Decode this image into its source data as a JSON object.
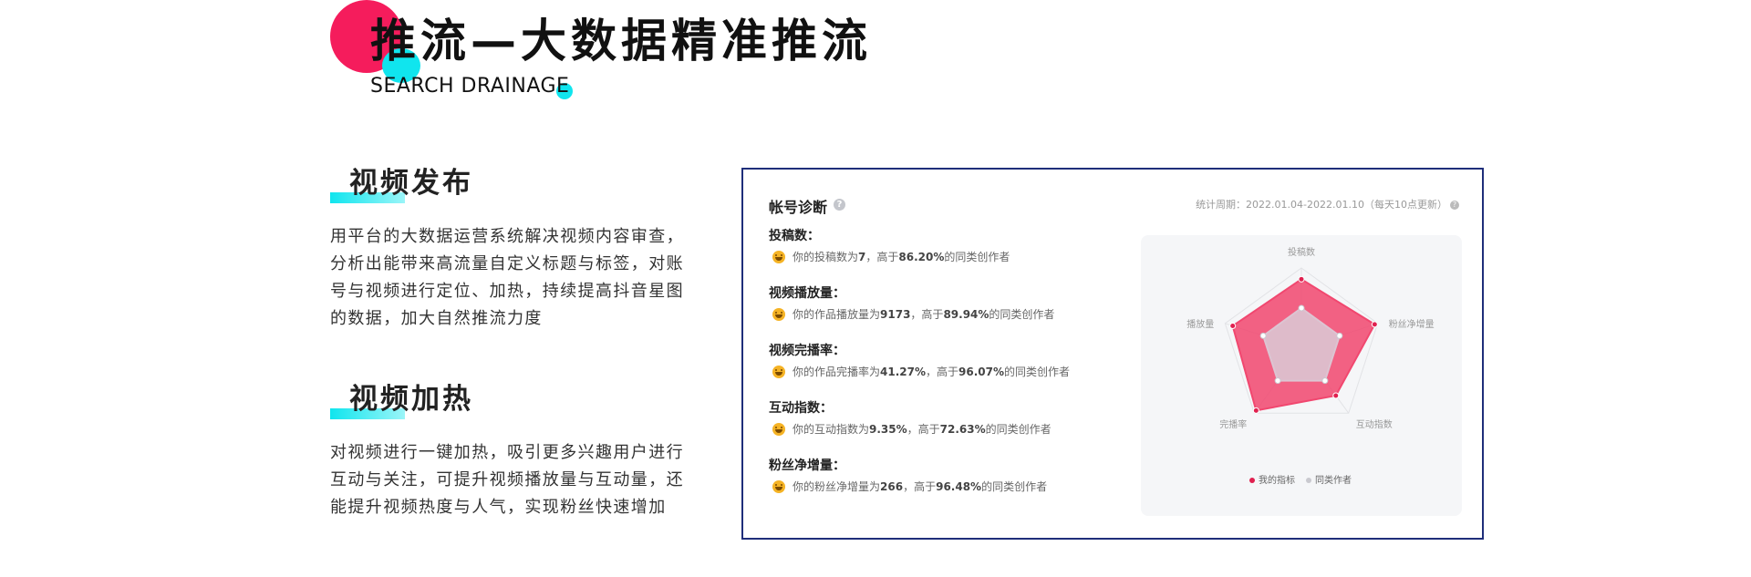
{
  "header": {
    "title": "推流—大数据精准推流",
    "subtitle": "SEARCH DRAINAGE"
  },
  "sections": [
    {
      "title": "视频发布",
      "body": "用平台的大数据运营系统解决视频内容审查，分析出能带来高流量自定义标题与标签，对账号与视频进行定位、加热，持续提高抖音星图的数据，加大自然推流力度"
    },
    {
      "title": "视频加热",
      "body": "对视频进行一键加热，吸引更多兴趣用户进行互动与关注，可提升视频播放量与互动量，还能提升视频热度与人气，实现粉丝快速增加"
    }
  ],
  "panel": {
    "title": "帐号诊断",
    "help_icon": "help-circle-icon",
    "period": "统计周期：2022.01.04-2022.01.10（每天10点更新）",
    "metrics": [
      {
        "label": "投稿数：",
        "prefix": "你的投稿数为",
        "value": "7",
        "mid": "，高于",
        "percent": "86.20%",
        "suffix": "的同类创作者"
      },
      {
        "label": "视频播放量：",
        "prefix": "你的作品播放量为",
        "value": "9173",
        "mid": "，高于",
        "percent": "89.94%",
        "suffix": "的同类创作者"
      },
      {
        "label": "视频完播率：",
        "prefix": "你的作品完播率为",
        "value": "41.27%",
        "mid": "，高于",
        "percent": "96.07%",
        "suffix": "的同类创作者"
      },
      {
        "label": "互动指数：",
        "prefix": "你的互动指数为",
        "value": "9.35%",
        "mid": "，高于",
        "percent": "72.63%",
        "suffix": "的同类创作者"
      },
      {
        "label": "粉丝净增量：",
        "prefix": "你的粉丝净增量为",
        "value": "266",
        "mid": "，高于",
        "percent": "96.48%",
        "suffix": "的同类创作者"
      }
    ],
    "emoji_icon": "smile-emoji-icon"
  },
  "chart_data": {
    "type": "radar",
    "axes": [
      "投稿数",
      "粉丝净增量",
      "互动指数",
      "完播率",
      "播放量"
    ],
    "series": [
      {
        "name": "我的指标",
        "values": [
          0.86,
          0.96,
          0.73,
          0.96,
          0.9
        ],
        "color": "#f1476f"
      },
      {
        "name": "同类作者",
        "values": [
          0.5,
          0.5,
          0.5,
          0.5,
          0.5
        ],
        "color": "#dcc5d2"
      }
    ],
    "range": [
      0,
      1
    ],
    "legend": "bottom"
  },
  "colors": {
    "accent_red": "#f51c5c",
    "accent_cyan": "#10e5ee",
    "panel_border": "#1f2e7a"
  }
}
